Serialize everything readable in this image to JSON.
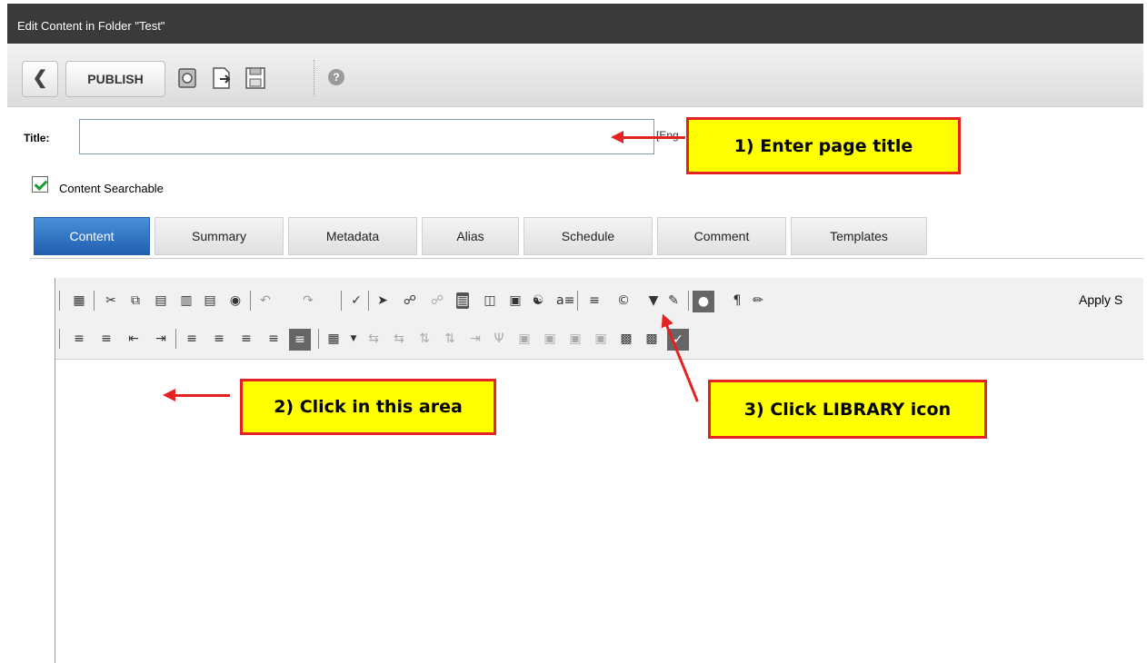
{
  "window": {
    "title": "Edit Content in Folder \"Test\""
  },
  "toolbar": {
    "back_icon": "chevron-left-icon",
    "publish_label": "PUBLISH",
    "icons": [
      "checkin-icon",
      "preview-icon",
      "save-icon"
    ],
    "help_icon": "help-icon"
  },
  "form": {
    "title_label": "Title:",
    "title_value": "",
    "language_text": "[Eng",
    "searchable_checked": true,
    "searchable_label": "Content Searchable"
  },
  "tabs": [
    {
      "label": "Content",
      "active": true
    },
    {
      "label": "Summary",
      "active": false
    },
    {
      "label": "Metadata",
      "active": false
    },
    {
      "label": "Alias",
      "active": false
    },
    {
      "label": "Schedule",
      "active": false
    },
    {
      "label": "Comment",
      "active": false
    },
    {
      "label": "Templates",
      "active": false
    }
  ],
  "editor": {
    "apply_style_text": "Apply S",
    "row1_icons": [
      "select-all-icon",
      "cut-icon",
      "copy-icon",
      "paste-icon",
      "paste-text-icon",
      "paste-word-icon",
      "find-icon",
      "undo-icon",
      "redo-icon",
      "spellcheck-icon",
      "hyperlink-icon",
      "link-icon",
      "unlink-icon",
      "library-icon",
      "insert-form-icon",
      "template-icon",
      "translate-icon",
      "list-icon",
      "symbol-icon",
      "validate-icon",
      "toggle-icon",
      "paragraph-icon",
      "format-brush-icon"
    ],
    "row2_icons": [
      "ordered-list-icon",
      "unordered-list-icon",
      "outdent-icon",
      "indent-icon",
      "align-left-icon",
      "align-center-icon",
      "align-right-icon",
      "justify-icon",
      "justify-full-icon",
      "table-icon",
      "insert-row-above-icon",
      "insert-row-below-icon",
      "insert-col-left-icon",
      "insert-col-right-icon",
      "delete-row-icon",
      "delete-col-icon",
      "merge-cells-icon",
      "split-cells-icon",
      "cell-props-icon",
      "table-props-icon",
      "insert-cell-icon",
      "delete-cell-icon",
      "check-icon"
    ]
  },
  "annotations": {
    "step1": "1)  Enter page title",
    "step2": "2) Click in this area",
    "step3": "3) Click LIBRARY icon"
  },
  "colors": {
    "accent": "#1f5fb0",
    "callout_fill": "#ffff00",
    "callout_border": "#e52222"
  }
}
